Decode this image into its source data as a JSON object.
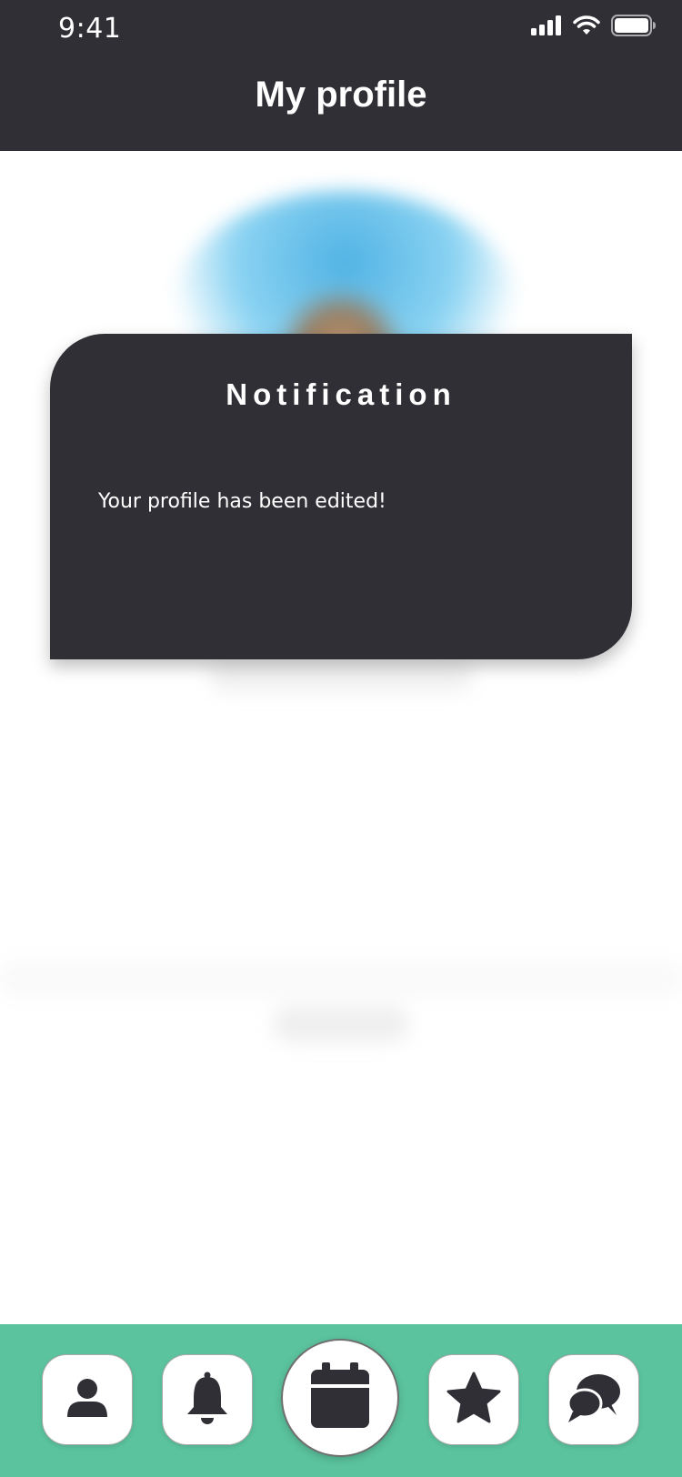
{
  "status_bar": {
    "time": "9:41",
    "icons": [
      "signal-icon",
      "wifi-icon",
      "battery-icon"
    ]
  },
  "header": {
    "title": "My profile"
  },
  "notification": {
    "title": "Notification",
    "message": "Your profile has been edited!"
  },
  "bottom_nav": {
    "items": [
      {
        "icon": "profile-icon"
      },
      {
        "icon": "bell-icon"
      },
      {
        "icon": "calendar-icon",
        "active": true
      },
      {
        "icon": "star-icon"
      },
      {
        "icon": "chat-icon"
      }
    ]
  },
  "colors": {
    "dark": "#312f36",
    "accent_green": "#5bc39e",
    "background": "#ffffff"
  }
}
